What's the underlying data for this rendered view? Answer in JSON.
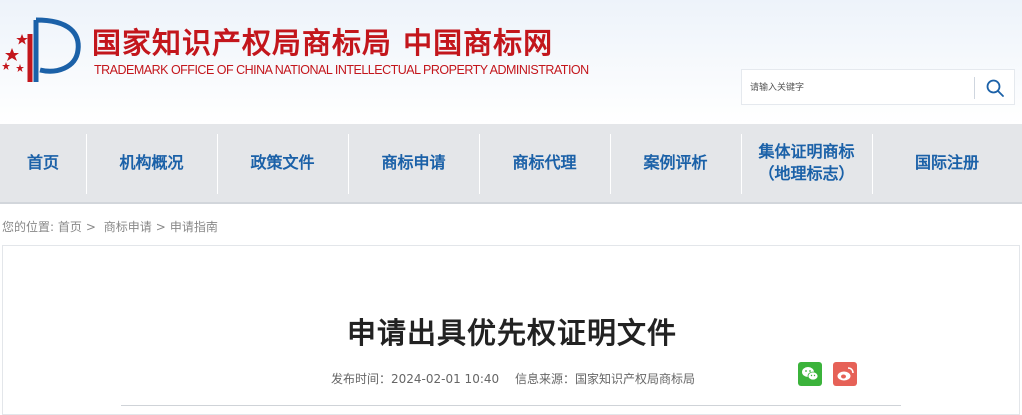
{
  "header": {
    "org_name_cn": "国家知识产权局商标局 中国商标网",
    "org_name_en": "TRADEMARK OFFICE OF CHINA NATIONAL INTELLECTUAL PROPERTY ADMINISTRATION",
    "logo_color": "#c3161c"
  },
  "search": {
    "placeholder": "请输入关键字",
    "icon": "search-icon"
  },
  "nav": {
    "items": [
      {
        "label": "首页"
      },
      {
        "label": "机构概况"
      },
      {
        "label": "政策文件"
      },
      {
        "label": "商标申请"
      },
      {
        "label": "商标代理"
      },
      {
        "label": "案例评析"
      },
      {
        "label": "集体证明商标\n（地理标志）"
      },
      {
        "label": "国际注册"
      }
    ],
    "text_color": "#1b61a8"
  },
  "breadcrumb": {
    "prefix": "您的位置:",
    "home": "首页",
    "level1": "商标申请",
    "level2": "申请指南"
  },
  "article": {
    "title": "申请出具优先权证明文件",
    "publish_time": "发布时间：2024-02-01 10:40",
    "source": "信息来源：国家知识产权局商标局"
  },
  "share": {
    "wechat_icon": "wechat-icon",
    "weibo_icon": "weibo-icon",
    "wechat_color": "#3bb33b",
    "weibo_color": "#e66157"
  }
}
